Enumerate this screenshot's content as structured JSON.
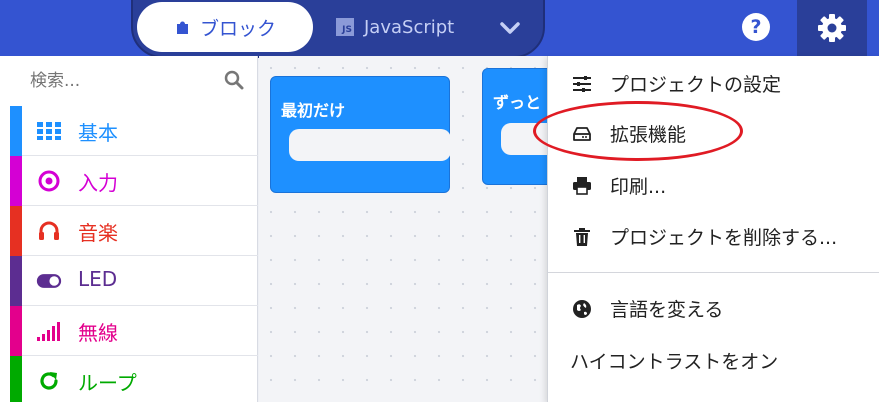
{
  "editor": {
    "blocks_label": "ブロック",
    "js_label": "JavaScript",
    "js_badge": "JS"
  },
  "header": {
    "help_label": "?"
  },
  "search": {
    "placeholder": "検索..."
  },
  "categories": [
    {
      "label": "基本",
      "color": "#1e90ff",
      "icon": "grid-icon"
    },
    {
      "label": "入力",
      "color": "#d400d4",
      "icon": "target-icon"
    },
    {
      "label": "音楽",
      "color": "#e63022",
      "icon": "headphones-icon"
    },
    {
      "label": "LED",
      "color": "#5c2d91",
      "icon": "toggle-icon"
    },
    {
      "label": "無線",
      "color": "#e3008c",
      "icon": "signal-icon"
    },
    {
      "label": "ループ",
      "color": "#00aa00",
      "icon": "loop-icon"
    }
  ],
  "workspace": {
    "blocks": [
      {
        "label": "最初だけ"
      },
      {
        "label": "ずっと"
      }
    ]
  },
  "menu": {
    "items": [
      {
        "label": "プロジェクトの設定",
        "icon": "sliders-icon"
      },
      {
        "label": "拡張機能",
        "icon": "drive-icon"
      },
      {
        "label": "印刷...",
        "icon": "printer-icon"
      },
      {
        "label": "プロジェクトを削除する...",
        "icon": "trash-icon"
      },
      {
        "label": "言語を変える",
        "icon": "globe-icon"
      },
      {
        "label": "ハイコントラストをオン",
        "icon": ""
      }
    ]
  },
  "colors": {
    "header": "#3454d1",
    "header_dark": "#2a3f99",
    "highlight": "#e01b24"
  }
}
